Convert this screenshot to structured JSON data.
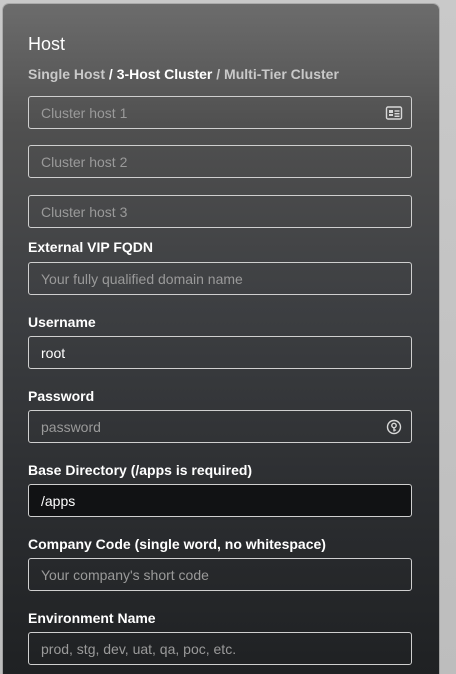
{
  "header": {
    "title": "Host",
    "tabs": [
      {
        "label": "Single Host",
        "active": false
      },
      {
        "label": "3-Host Cluster",
        "active": true
      },
      {
        "label": "Multi-Tier Cluster",
        "active": false
      }
    ],
    "separator": "/"
  },
  "fields": {
    "cluster_host_1": {
      "placeholder": "Cluster host 1",
      "value": "",
      "icon": "contact-card-icon"
    },
    "cluster_host_2": {
      "placeholder": "Cluster host 2",
      "value": ""
    },
    "cluster_host_3": {
      "placeholder": "Cluster host 3",
      "value": ""
    },
    "external_vip": {
      "label": "External VIP FQDN",
      "placeholder": "Your fully qualified domain name",
      "value": ""
    },
    "username": {
      "label": "Username",
      "value": "root"
    },
    "password": {
      "label": "Password",
      "placeholder": "password",
      "value": "",
      "icon": "password-key-icon"
    },
    "base_directory": {
      "label": "Base Directory (/apps is required)",
      "value": "/apps"
    },
    "company_code": {
      "label": "Company Code (single word, no whitespace)",
      "placeholder": "Your company's short code",
      "value": ""
    },
    "environment_name": {
      "label": "Environment Name",
      "placeholder": "prod, stg, dev, uat, qa, poc, etc.",
      "value": ""
    }
  }
}
